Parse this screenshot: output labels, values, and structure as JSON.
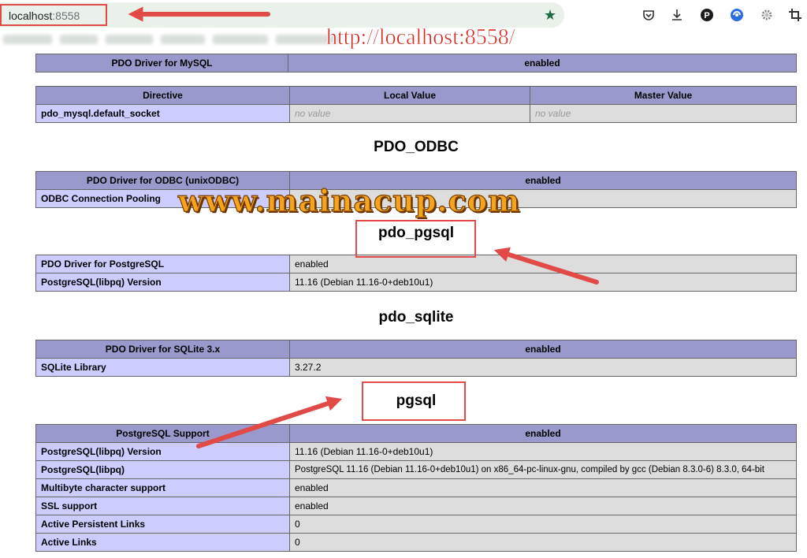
{
  "browser": {
    "url_host": "localhost",
    "url_port": ":8558",
    "toolbar_icons": [
      "pocket-icon",
      "download-icon",
      "profile-p-icon",
      "copilot-icon",
      "extension-gear-icon",
      "crop-icon"
    ]
  },
  "annotations": {
    "url_text": "http://localhost:8558/",
    "watermark": "www.mainacup.com",
    "colors": {
      "annotation_red": "#e14a46",
      "watermark_orange": "#f4a51c"
    }
  },
  "phpinfo": {
    "colors": {
      "header": "#9999cc",
      "key": "#ccccff",
      "value": "#dddddd"
    },
    "mysql_driver": {
      "label": "PDO Driver for MySQL",
      "value": "enabled"
    },
    "directive_table": {
      "headers": [
        "Directive",
        "Local Value",
        "Master Value"
      ],
      "row": {
        "key": "pdo_mysql.default_socket",
        "local": "no value",
        "master": "no value"
      }
    },
    "pdo_odbc": {
      "title": "PDO_ODBC",
      "header": {
        "label": "PDO Driver for ODBC (unixODBC)",
        "value": "enabled"
      },
      "rows": [
        {
          "key": "ODBC Connection Pooling",
          "value": ""
        }
      ]
    },
    "pdo_pgsql": {
      "title": "pdo_pgsql",
      "rows": [
        {
          "key": "PDO Driver for PostgreSQL",
          "value": "enabled"
        },
        {
          "key": "PostgreSQL(libpq) Version",
          "value": "11.16 (Debian 11.16-0+deb10u1)"
        }
      ]
    },
    "pdo_sqlite": {
      "title": "pdo_sqlite",
      "header": {
        "label": "PDO Driver for SQLite 3.x",
        "value": "enabled"
      },
      "rows": [
        {
          "key": "SQLite Library",
          "value": "3.27.2"
        }
      ]
    },
    "pgsql": {
      "title": "pgsql",
      "header": {
        "label": "PostgreSQL Support",
        "value": "enabled"
      },
      "rows": [
        {
          "key": "PostgreSQL(libpq) Version",
          "value": "11.16 (Debian 11.16-0+deb10u1)"
        },
        {
          "key": "PostgreSQL(libpq)",
          "value": "PostgreSQL 11.16 (Debian 11.16-0+deb10u1) on x86_64-pc-linux-gnu, compiled by gcc (Debian 8.3.0-6) 8.3.0, 64-bit"
        },
        {
          "key": "Multibyte character support",
          "value": "enabled"
        },
        {
          "key": "SSL support",
          "value": "enabled"
        },
        {
          "key": "Active Persistent Links",
          "value": "0"
        },
        {
          "key": "Active Links",
          "value": "0"
        }
      ]
    }
  }
}
